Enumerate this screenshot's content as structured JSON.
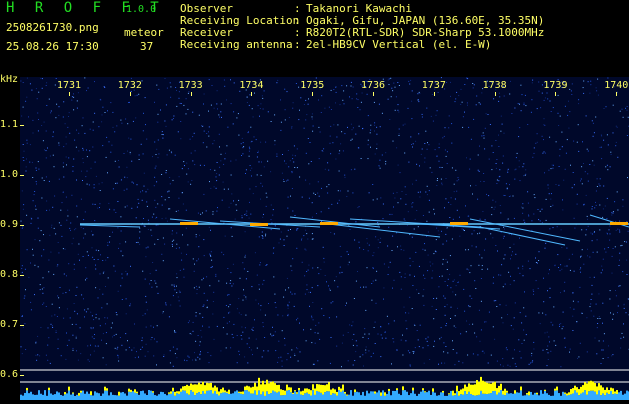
{
  "header": {
    "app_logo": "H R O F F T",
    "app_version": "1.0.0",
    "file_name": "2508261730.png",
    "meteor_label": "meteor",
    "date_time": "25.08.26 17:30",
    "meteor_count": "37",
    "info": [
      {
        "label": "Observer",
        "value": "Takanori Kawachi"
      },
      {
        "label": "Receiving Location",
        "value": "Ogaki, Gifu, JAPAN (136.60E, 35.35N)"
      },
      {
        "label": "Receiver",
        "value": "R820T2(RTL-SDR) SDR-Sharp 53.1000MHz"
      },
      {
        "label": "Receiving antenna",
        "value": "2el-HB9CV Vertical (el. E-W)"
      }
    ],
    "colon": ":"
  },
  "axis": {
    "y_unit": "kHz",
    "y_ticks": [
      "1.1",
      "1.0",
      "0.9",
      "0.8",
      "0.7",
      "0.6"
    ],
    "x_ticks": [
      "1731",
      "1732",
      "1733",
      "1734",
      "1735",
      "1736",
      "1737",
      "1738",
      "1739",
      "1740"
    ]
  },
  "colors": {
    "text": "#ffff66",
    "logo": "#22dd22",
    "background": "#00082a",
    "carrier": "#66ccff",
    "meteor_hot": "#ffaa00",
    "bar_blue": "#33aaff",
    "bar_yellow": "#ffff00"
  }
}
